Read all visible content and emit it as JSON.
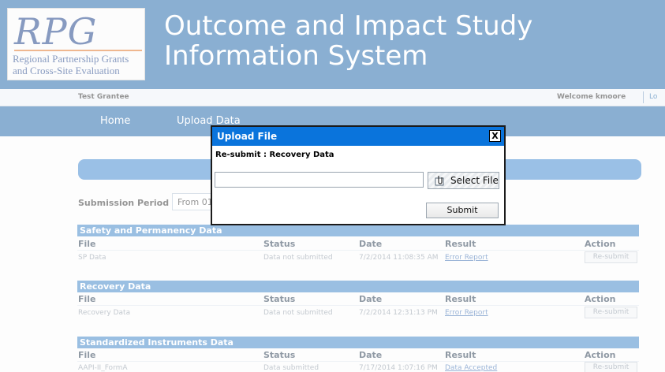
{
  "header": {
    "logo_mark": "RPG",
    "logo_line1": "Regional Partnership Grants",
    "logo_line2": "and Cross-Site Evaluation",
    "title": "Outcome and Impact Study Information System"
  },
  "userbar": {
    "grantee": "Test Grantee",
    "welcome": "Welcome kmoore",
    "logout": "Lo"
  },
  "nav": {
    "items": [
      {
        "label": "Home"
      },
      {
        "label": "Upload Data"
      }
    ]
  },
  "submission": {
    "label": "Submission Period :",
    "value": "From 01"
  },
  "columns": {
    "file": "File",
    "status": "Status",
    "date": "Date",
    "result": "Result",
    "action": "Action"
  },
  "sections": [
    {
      "title": "Safety and Permanency Data",
      "rows": [
        {
          "file": "SP Data",
          "status": "Data not submitted",
          "date": "7/2/2014 11:08:35 AM",
          "result": "Error Report",
          "action": "Re-submit"
        }
      ]
    },
    {
      "title": "Recovery Data",
      "rows": [
        {
          "file": "Recovery Data",
          "status": "Data not submitted",
          "date": "7/2/2014 12:31:13 PM",
          "result": "Error Report",
          "action": "Re-submit"
        }
      ]
    },
    {
      "title": "Standardized Instruments Data",
      "rows": [
        {
          "file": "AAPI-II_FormA",
          "status": "Data submitted",
          "date": "7/17/2014 1:07:16 PM",
          "result": "Data Accepted",
          "action": "Re-submit"
        }
      ]
    }
  ],
  "dialog": {
    "title": "Upload File",
    "close": "X",
    "subtitle": "Re-submit : Recovery Data",
    "file_value": "",
    "select_label": "Select File",
    "submit_label": "Submit"
  },
  "colors": {
    "header_blue": "#1f66a9",
    "dialog_title_blue": "#0a74dc",
    "section_blue": "#3f85c8"
  }
}
